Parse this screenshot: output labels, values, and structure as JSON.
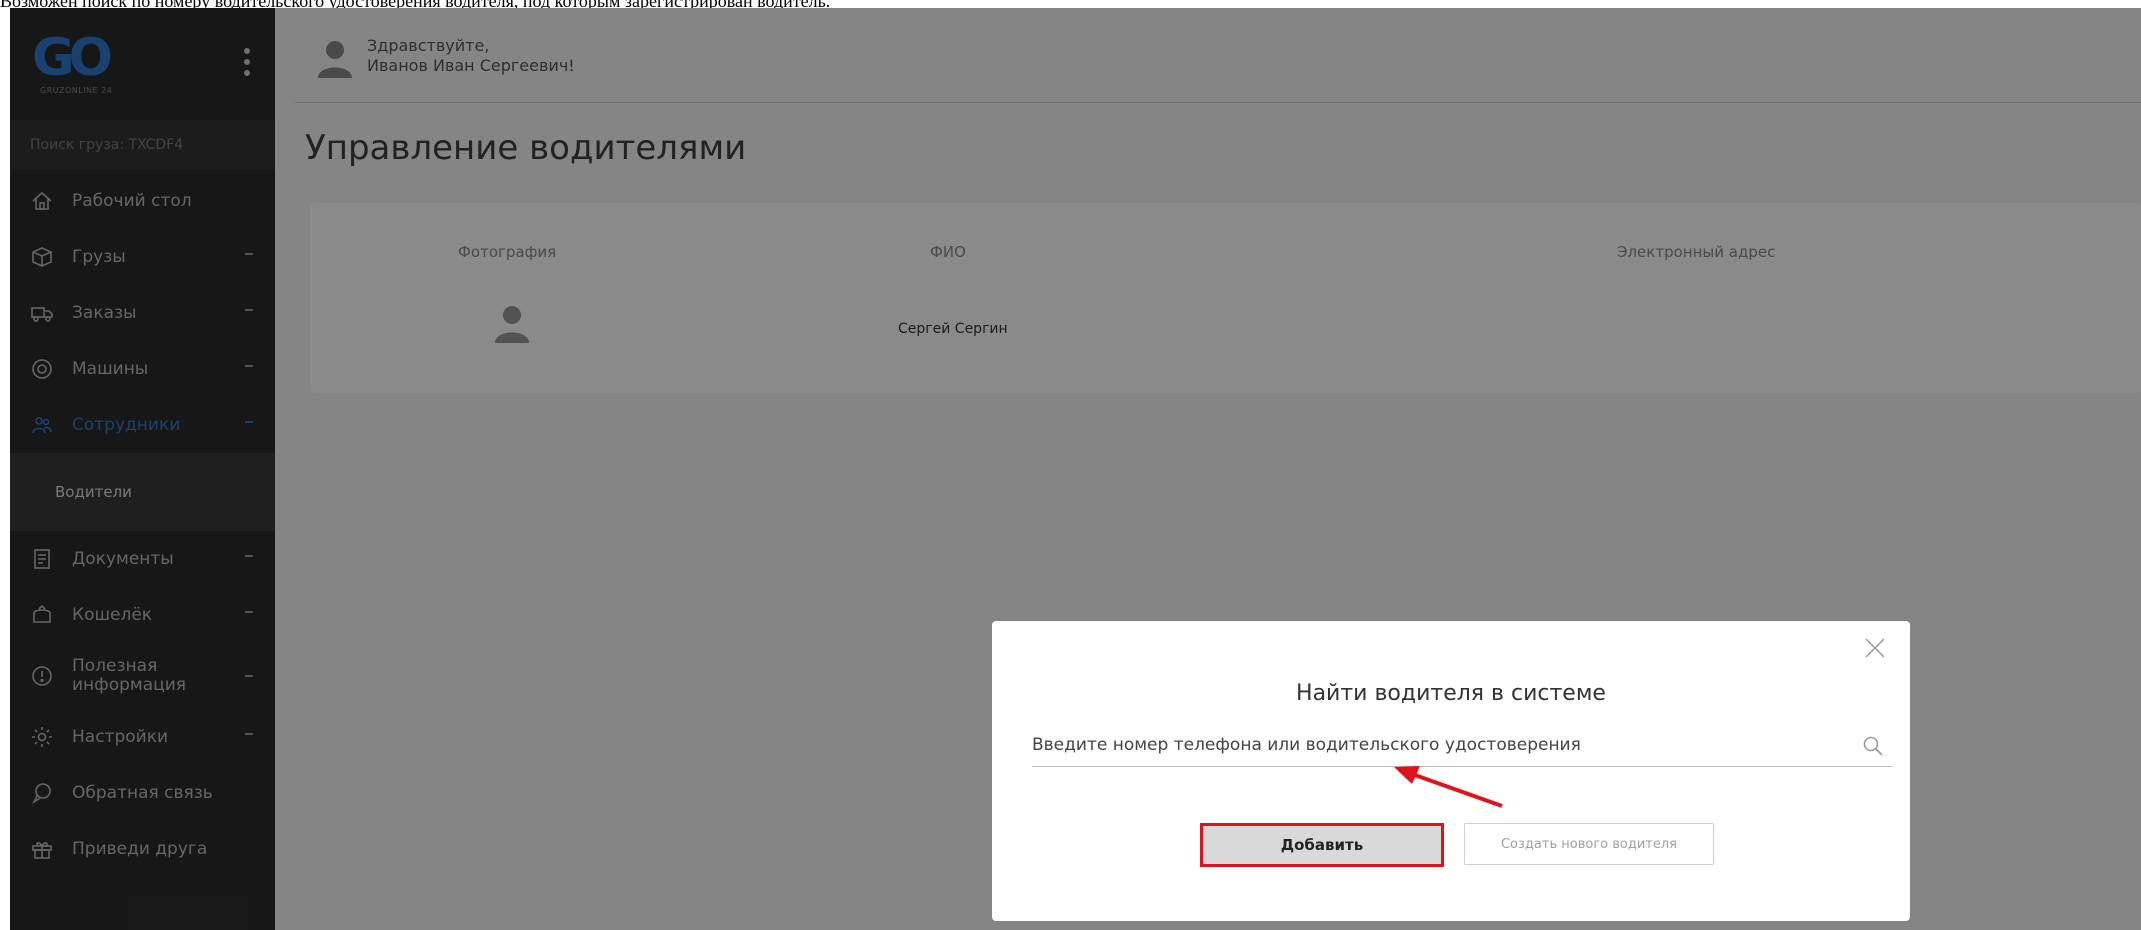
{
  "caption": "Возможен поиск по номеру водительского удостоверения водителя, под которым зарегистрирован водитель.",
  "sidebar": {
    "logo": "GO",
    "logo_sub": "GRUZONLINE 24",
    "search_placeholder": "Поиск груза: TXCDF4",
    "items": [
      {
        "label": "Рабочий стол",
        "icon": "home-icon"
      },
      {
        "label": "Грузы",
        "icon": "cube-icon"
      },
      {
        "label": "Заказы",
        "icon": "truck-icon"
      },
      {
        "label": "Машины",
        "icon": "wheel-icon"
      },
      {
        "label": "Сотрудники",
        "icon": "users-icon"
      },
      {
        "label": "Документы",
        "icon": "document-icon"
      },
      {
        "label": "Кошелёк",
        "icon": "wallet-icon"
      },
      {
        "label_line1": "Полезная",
        "label_line2": "информация",
        "icon": "info-icon"
      },
      {
        "label": "Настройки",
        "icon": "gear-icon"
      },
      {
        "label": "Обратная связь",
        "icon": "chat-icon"
      },
      {
        "label": "Приведи друга",
        "icon": "gift-icon"
      }
    ],
    "sub_item": "Водители"
  },
  "header": {
    "greeting_line1": "Здравствуйте,",
    "greeting_line2": "Иванов Иван Сергеевич!"
  },
  "page_title": "Управление водителями",
  "table": {
    "columns": [
      "Фотография",
      "ФИО",
      "Электронный адрес"
    ],
    "rows": [
      {
        "name": "Сергей Сергин"
      }
    ]
  },
  "modal": {
    "title": "Найти водителя в системе",
    "search_placeholder": "Введите номер телефона или водительского удостоверения",
    "add_label": "Добавить",
    "create_label": "Создать нового водителя"
  },
  "colors": {
    "accent": "#2f7bd1",
    "highlight": "#e0131a",
    "sidebar": "#2c2c2c"
  }
}
